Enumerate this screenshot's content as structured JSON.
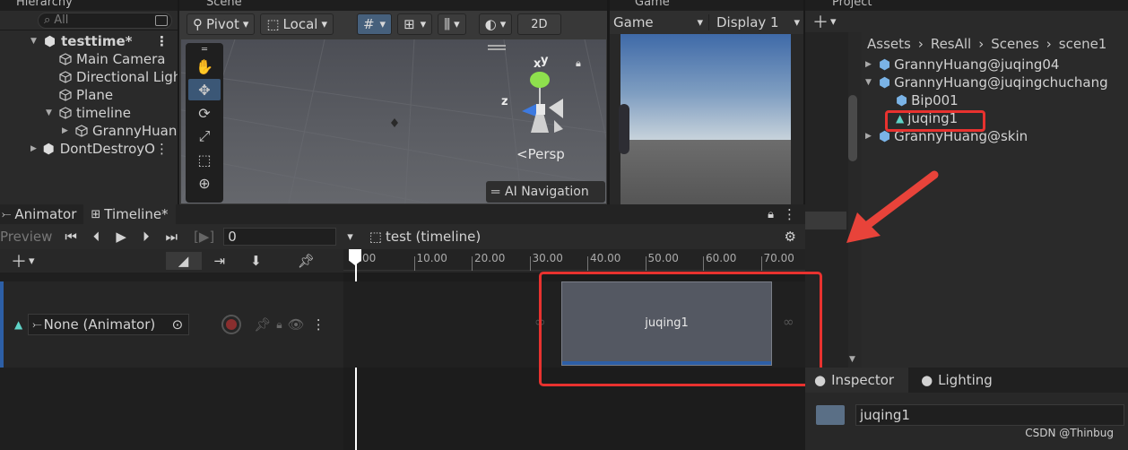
{
  "hierarchy": {
    "tab": "Hierarchy",
    "search_placeholder": "All",
    "items": [
      {
        "label": "testtime*"
      },
      {
        "label": "Main Camera"
      },
      {
        "label": "Directional Ligh"
      },
      {
        "label": "Plane"
      },
      {
        "label": "timeline"
      },
      {
        "label": "GrannyHuan"
      },
      {
        "label": "DontDestroyO"
      }
    ]
  },
  "scene": {
    "tab": "Scene",
    "pivot": "Pivot",
    "local": "Local",
    "mode2d": "2D",
    "persp": "Persp",
    "overlay": "AI Navigation",
    "axis_y": "y",
    "axis_x": "x",
    "axis_z": "z"
  },
  "game": {
    "tab": "Game",
    "view": "Game",
    "display": "Display 1"
  },
  "project": {
    "tab": "Project",
    "breadcrumb": [
      "Assets",
      "ResAll",
      "Scenes",
      "scene1"
    ],
    "items": [
      {
        "label": "GrannyHuang@juqing04"
      },
      {
        "label": "GrannyHuang@juqingchuchang"
      },
      {
        "label": "Bip001"
      },
      {
        "label": "juqing1"
      },
      {
        "label": "GrannyHuang@skin"
      }
    ]
  },
  "timeline": {
    "tab_animator": "Animator",
    "tab_timeline": "Timeline*",
    "preview": "Preview",
    "frame_value": "0",
    "asset": "test (timeline)",
    "ruler_labels": [
      ":00",
      "10.00",
      "20.00",
      "30.00",
      "40.00",
      "50.00",
      "60.00",
      "70.00"
    ],
    "track_binding": "None (Animator)",
    "clip_label": "juqing1"
  },
  "inspector": {
    "tab_inspector": "Inspector",
    "tab_lighting": "Lighting",
    "name_value": "juqing1"
  },
  "watermark": "CSDN @Thinbug",
  "colors": {
    "highlight_red": "#e8322f",
    "arrow_red": "#e8433a",
    "accent_blue": "#2d5fa6",
    "clip_bg": "#545862"
  }
}
